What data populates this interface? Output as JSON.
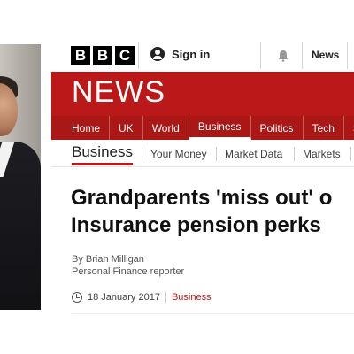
{
  "header": {
    "logo_letters": [
      "B",
      "B",
      "C"
    ],
    "signin_label": "Sign in",
    "news_link": "News"
  },
  "masthead": {
    "title": "NEWS"
  },
  "nav": {
    "items": [
      "Home",
      "UK",
      "World",
      "Business",
      "Politics",
      "Tech",
      "S"
    ],
    "active": "Business"
  },
  "subnav": {
    "section_title": "Business",
    "items": [
      "Your Money",
      "Market Data",
      "Markets"
    ]
  },
  "article": {
    "headline_line1": "Grandparents 'miss out' o",
    "headline_line2": "Insurance pension perks",
    "author": "By Brian Milligan",
    "author_role": "Personal Finance reporter",
    "date": "18 January 2017",
    "section": "Business"
  },
  "colors": {
    "bbc_red": "#bb1919",
    "nav_red": "#a91717"
  },
  "icons": [
    "user-icon",
    "bell-icon",
    "clock-icon"
  ]
}
